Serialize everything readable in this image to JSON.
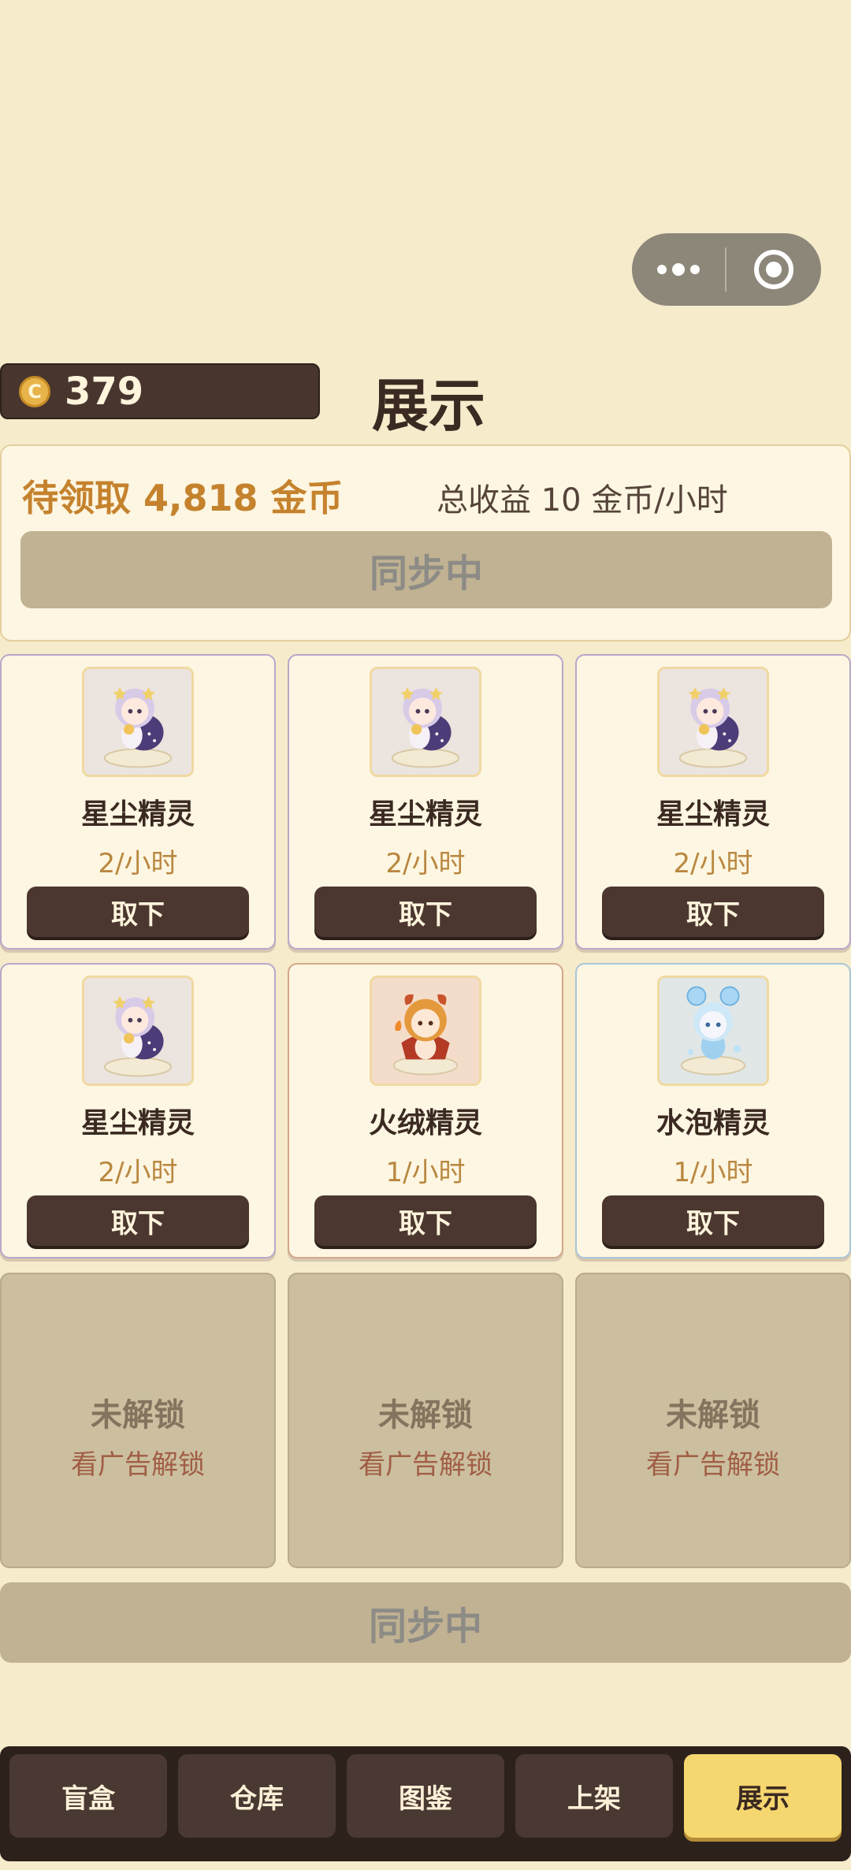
{
  "header": {
    "coins": "379",
    "coin_symbol": "C",
    "title": "展示"
  },
  "income": {
    "pending": "待领取 4,818 金币",
    "total": "总收益 10 金币/小时",
    "sync_label": "同步中"
  },
  "slots": [
    {
      "name": "星尘精灵",
      "rate": "2/小时",
      "button": "取下"
    },
    {
      "name": "星尘精灵",
      "rate": "2/小时",
      "button": "取下"
    },
    {
      "name": "星尘精灵",
      "rate": "2/小时",
      "button": "取下"
    },
    {
      "name": "星尘精灵",
      "rate": "2/小时",
      "button": "取下"
    },
    {
      "name": "火绒精灵",
      "rate": "1/小时",
      "button": "取下"
    },
    {
      "name": "水泡精灵",
      "rate": "1/小时",
      "button": "取下"
    }
  ],
  "locked_slots": [
    {
      "label": "未解锁",
      "hint": "看广告解锁"
    },
    {
      "label": "未解锁",
      "hint": "看广告解锁"
    },
    {
      "label": "未解锁",
      "hint": "看广告解锁"
    }
  ],
  "bottom_sync_label": "同步中",
  "tabs": [
    {
      "label": "盲盒",
      "active": false
    },
    {
      "label": "仓库",
      "active": false
    },
    {
      "label": "图鉴",
      "active": false
    },
    {
      "label": "上架",
      "active": false
    },
    {
      "label": "展示",
      "active": true
    }
  ],
  "colors": {
    "background": "#f6ebcb",
    "accent": "#f6d66e",
    "dark": "#4b372f",
    "gold_text": "#c5822d"
  }
}
